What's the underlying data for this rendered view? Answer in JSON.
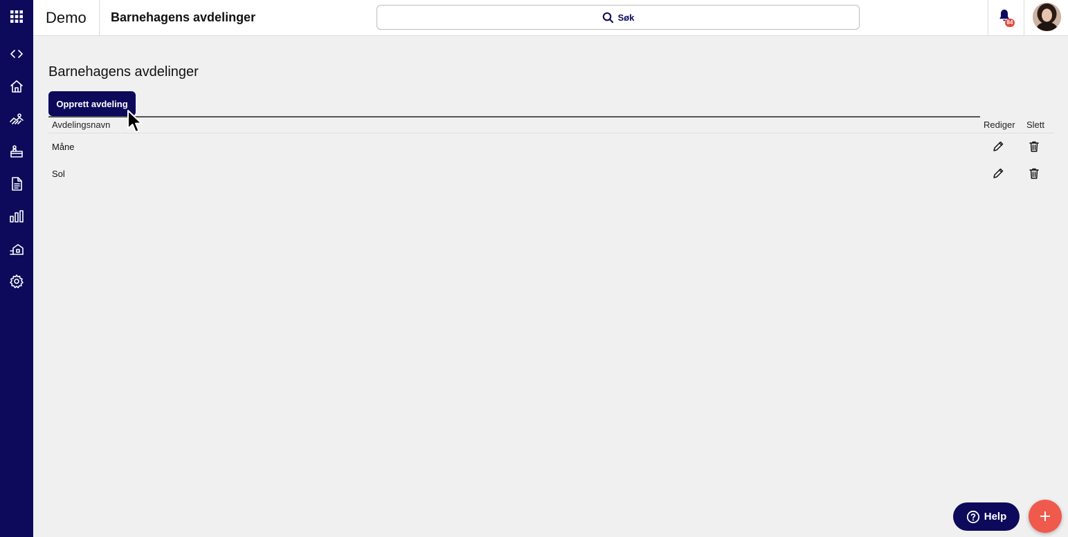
{
  "sidebar": {
    "items": [
      {
        "name": "apps-grid-icon"
      },
      {
        "name": "code-brackets-icon"
      },
      {
        "name": "home-icon"
      },
      {
        "name": "hands-icon"
      },
      {
        "name": "classroom-icon"
      },
      {
        "name": "document-icon"
      },
      {
        "name": "bar-chart-icon"
      },
      {
        "name": "building-icon"
      },
      {
        "name": "gear-icon"
      }
    ]
  },
  "header": {
    "brand": "Demo",
    "title": "Barnehagens avdelinger",
    "search_label": "Søk",
    "notification_count": "84"
  },
  "main": {
    "page_title": "Barnehagens avdelinger",
    "create_button": "Opprett avdeling",
    "columns": {
      "name": "Avdelingsnavn",
      "edit": "Rediger",
      "delete": "Slett"
    },
    "rows": [
      {
        "name": "Måne"
      },
      {
        "name": "Sol"
      }
    ]
  },
  "help_label": "Help",
  "colors": {
    "brand_navy": "#0d0a5c",
    "accent_red": "#ef5a4d",
    "background": "#f0f0f0"
  }
}
